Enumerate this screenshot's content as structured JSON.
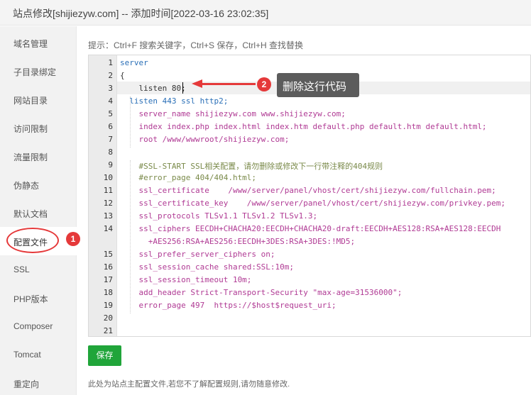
{
  "window": {
    "title": "站点修改[shijiezyw.com] -- 添加时间[2022-03-16 23:02:35]"
  },
  "sidebar": {
    "items": [
      {
        "label": "域名管理"
      },
      {
        "label": "子目录绑定"
      },
      {
        "label": "网站目录"
      },
      {
        "label": "访问限制"
      },
      {
        "label": "流量限制"
      },
      {
        "label": "伪静态"
      },
      {
        "label": "默认文档"
      },
      {
        "label": "配置文件",
        "active": true
      },
      {
        "label": "SSL"
      },
      {
        "label": "PHP版本"
      },
      {
        "label": "Composer"
      },
      {
        "label": "Tomcat"
      },
      {
        "label": "重定向"
      }
    ]
  },
  "editor": {
    "tip": "提示：Ctrl+F 搜索关键字，Ctrl+S 保存，Ctrl+H 查找替换",
    "line_numbers": [
      "1",
      "2",
      "3",
      "4",
      "5",
      "6",
      "7",
      "8",
      "9",
      "10",
      "11",
      "12",
      "13",
      "14",
      "",
      "15",
      "16",
      "17",
      "18",
      "19",
      "20",
      "21"
    ],
    "lines": [
      "server",
      "{",
      "    listen 80;",
      "  listen 443 ssl http2;",
      "    server_name shijiezyw.com www.shijiezyw.com;",
      "    index index.php index.html index.htm default.php default.htm default.html;",
      "    root /www/wwwroot/shijiezyw.com;",
      "",
      "    #SSL-START SSL相关配置，请勿删除或修改下一行带注释的404规则",
      "    #error_page 404/404.html;",
      "    ssl_certificate    /www/server/panel/vhost/cert/shijiezyw.com/fullchain.pem;",
      "    ssl_certificate_key    /www/server/panel/vhost/cert/shijiezyw.com/privkey.pem;",
      "    ssl_protocols TLSv1.1 TLSv1.2 TLSv1.3;",
      "    ssl_ciphers EECDH+CHACHA20:EECDH+CHACHA20-draft:EECDH+AES128:RSA+AES128:EECDH",
      "      +AES256:RSA+AES256:EECDH+3DES:RSA+3DES:!MD5;",
      "    ssl_prefer_server_ciphers on;",
      "    ssl_session_cache shared:SSL:10m;",
      "    ssl_session_timeout 10m;",
      "    add_header Strict-Transport-Security \"max-age=31536000\";",
      "    error_page 497  https://$host$request_uri;",
      "",
      ""
    ]
  },
  "annotations": {
    "badge1": "1",
    "badge2": "2",
    "callout": "删除这行代码"
  },
  "actions": {
    "save_label": "保存"
  },
  "footer": {
    "note": "此处为站点主配置文件,若您不了解配置规则,请勿随意修改."
  },
  "colors": {
    "accent_green": "#20a53a",
    "annotation_red": "#e5393a",
    "callout_bg": "#5c5c5c",
    "keyword_blue": "#2a6fb7"
  }
}
